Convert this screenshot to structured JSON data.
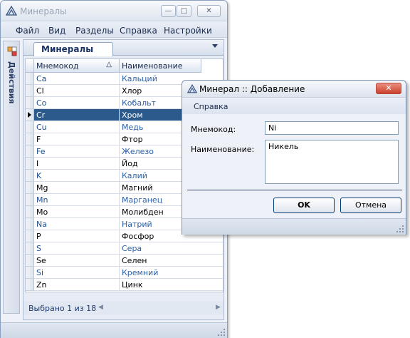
{
  "main_window": {
    "title": "Минералы",
    "buttons": {
      "minimize": "—",
      "maximize": "□",
      "close": "✕"
    },
    "menu": [
      "Файл",
      "Вид",
      "Разделы",
      "Справка",
      "Настройки"
    ],
    "side_panel_label": "Действия",
    "tab_label": "Минералы",
    "grid": {
      "columns": [
        "Мнемокод",
        "Наименование"
      ],
      "sort_indicator": "△",
      "rows": [
        {
          "code": "Ca",
          "name": "Кальций"
        },
        {
          "code": "Cl",
          "name": "Хлор"
        },
        {
          "code": "Co",
          "name": "Кобальт"
        },
        {
          "code": "Cr",
          "name": "Хром"
        },
        {
          "code": "Cu",
          "name": "Медь"
        },
        {
          "code": "F",
          "name": "Фтор"
        },
        {
          "code": "Fe",
          "name": "Железо"
        },
        {
          "code": "I",
          "name": "Йод"
        },
        {
          "code": "K",
          "name": "Калий"
        },
        {
          "code": "Mg",
          "name": "Магний"
        },
        {
          "code": "Mn",
          "name": "Марганец"
        },
        {
          "code": "Mo",
          "name": "Молибден"
        },
        {
          "code": "Na",
          "name": "Натрий"
        },
        {
          "code": "P",
          "name": "Фосфор"
        },
        {
          "code": "S",
          "name": "Сера"
        },
        {
          "code": "Se",
          "name": "Селен"
        },
        {
          "code": "Si",
          "name": "Кремний"
        },
        {
          "code": "Zn",
          "name": "Цинк"
        }
      ],
      "selected_row": 3
    },
    "status_text": "Выбрано 1 из 18"
  },
  "dialog": {
    "title": "Минерал :: Добавление",
    "close": "✕",
    "menu_item": "Справка",
    "code_label": "Мнемокод:",
    "code_value": "Ni",
    "name_label": "Наименование:",
    "name_value": "Никель",
    "ok_label": "OK",
    "cancel_label": "Отмена"
  },
  "colors": {
    "selected_row_bg": "#2c5a8c",
    "code_text_blue": "#1f4f8f",
    "name_text_blue": "#2a5fa8"
  }
}
